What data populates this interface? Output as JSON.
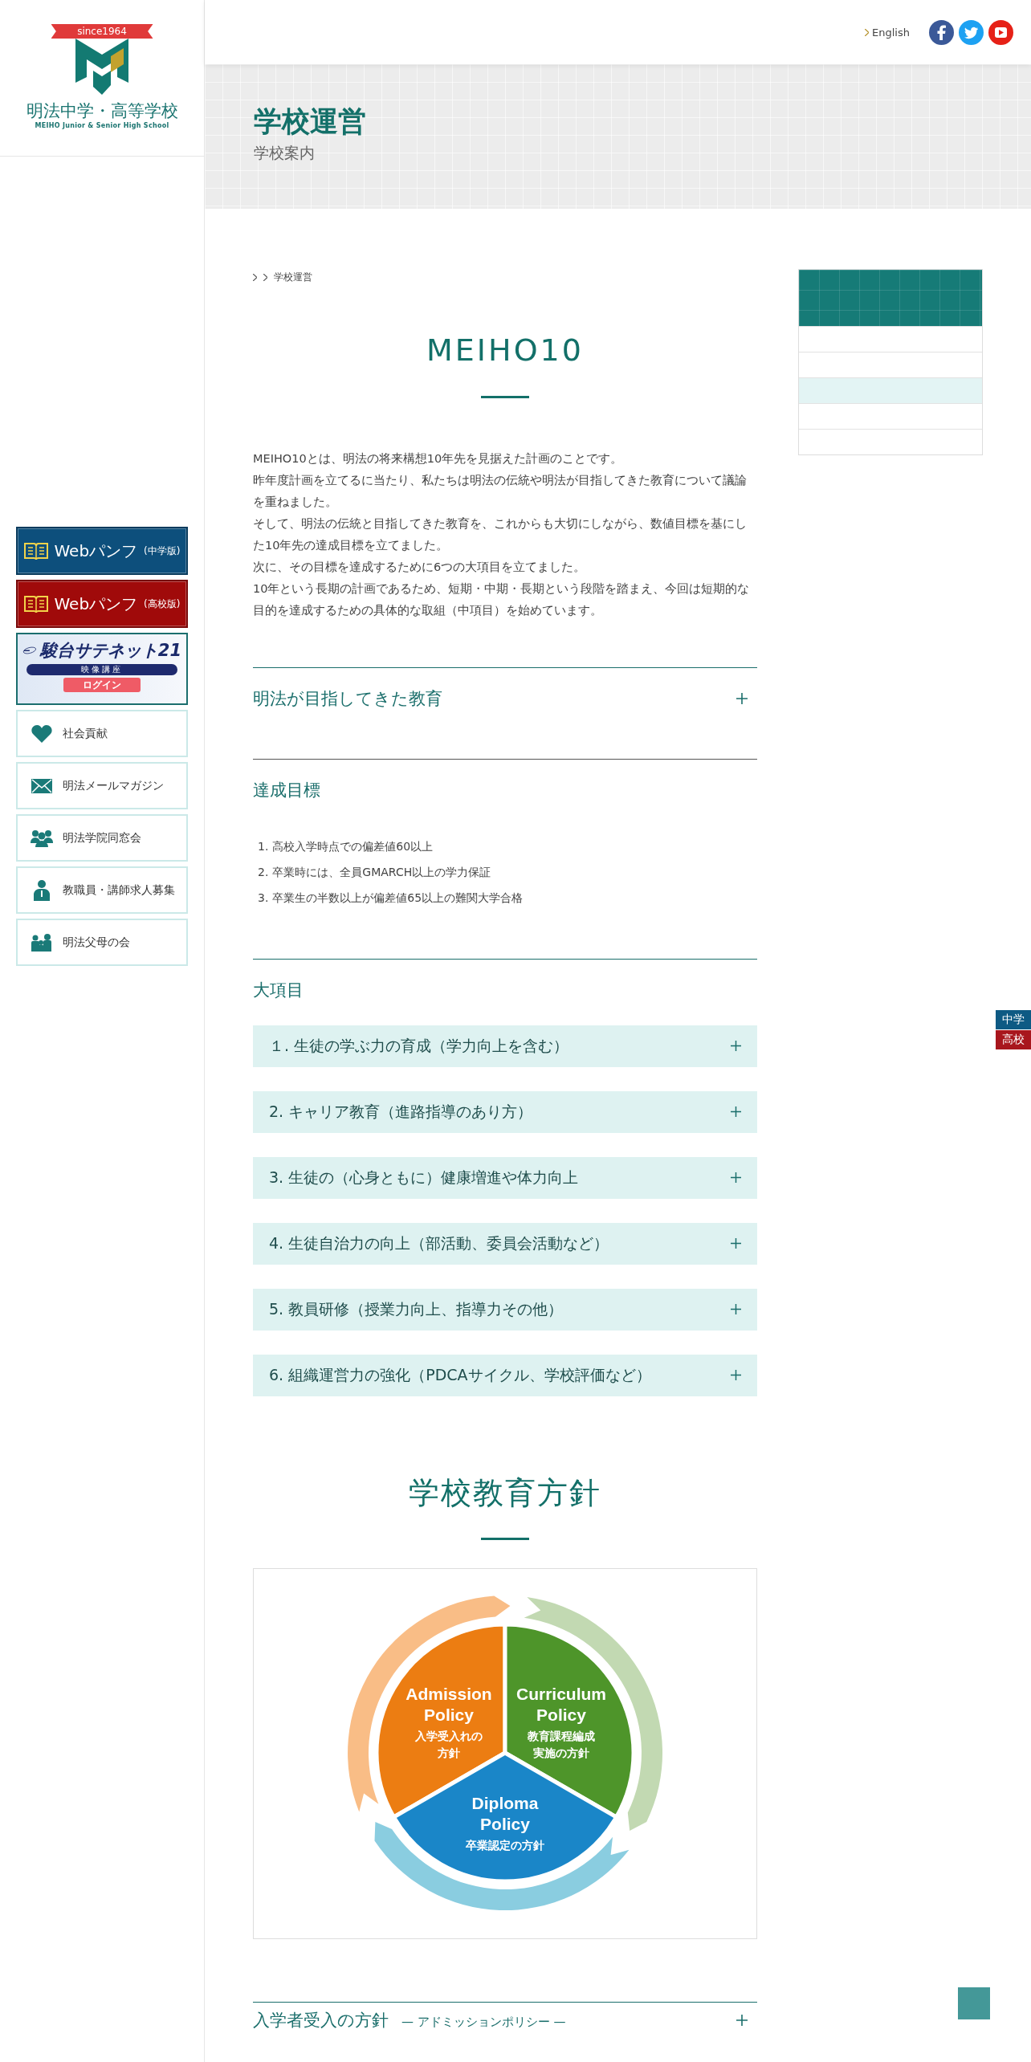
{
  "logo": {
    "badge": "since1964",
    "name": "明法中学・高等学校",
    "subtitle": "MEIHO Junior & Senior High School"
  },
  "header": {
    "language_link": "English",
    "social": [
      {
        "kind": "facebook"
      },
      {
        "kind": "twitter"
      },
      {
        "kind": "youtube"
      }
    ]
  },
  "page_header": {
    "title": "学校運営",
    "subtitle": "学校案内"
  },
  "sidebar": {
    "banners": [
      {
        "label": "Webパンフ",
        "edition": "(中学版)",
        "color": "#0d4f7c"
      },
      {
        "label": "Webパンフ",
        "edition": "(高校版)",
        "color": "#a00a0a"
      }
    ],
    "satenet": {
      "title": "駿台サテネット21",
      "tagline": "映像講座",
      "button": "ログイン"
    },
    "links": [
      {
        "kind": "heart",
        "label": "社会貢献"
      },
      {
        "kind": "mail",
        "label": "明法メールマガジン"
      },
      {
        "kind": "group",
        "label": "明法学院同窓会"
      },
      {
        "kind": "person",
        "label": "教職員・講師求人募集"
      },
      {
        "kind": "family",
        "label": "明法父母の会"
      }
    ]
  },
  "breadcrumb": {
    "current": "学校運営"
  },
  "section": {
    "title": "MEIHO10",
    "intro": [
      "MEIHO10とは、明法の将来構想10年先を見据えた計画のことです。",
      "昨年度計画を立てるに当たり、私たちは明法の伝統や明法が目指してきた教育について議論を重ねました。",
      "そして、明法の伝統と目指してきた教育を、これからも大切にしながら、数値目標を基にした10年先の達成目標を立てました。",
      "次に、その目標を達成するために6つの大項目を立てました。",
      "10年という長期の計画であるため、短期・中期・長期という段階を踏まえ、今回は短期的な目的を達成するための具体的な取組（中項目）を始めています。"
    ]
  },
  "accordion": {
    "title": "明法が目指してきた教育",
    "expanded": false
  },
  "goals": {
    "title": "達成目標",
    "items": [
      {
        "marker": "1.",
        "text": "高校入学時点での偏差値60以上"
      },
      {
        "marker": "2.",
        "text": "卒業時には、全員GMARCH以上の学力保証"
      },
      {
        "marker": "3.",
        "text": "卒業生の半数以上が偏差値65以上の難関大学合格"
      }
    ]
  },
  "major_items": {
    "title": "大項目",
    "items": [
      {
        "label": "１. 生徒の学ぶ力の育成（学力向上を含む）",
        "expanded": false
      },
      {
        "label": "2. キャリア教育（進路指導のあり方）",
        "expanded": false
      },
      {
        "label": "3. 生徒の（心身ともに）健康増進や体力向上",
        "expanded": false
      },
      {
        "label": "4. 生徒自治力の向上（部活動、委員会活動など）",
        "expanded": false
      },
      {
        "label": "5. 教員研修（授業力向上、指導力その他）",
        "expanded": false
      },
      {
        "label": "6. 組織運営力の強化（PDCAサイクル、学校評価など）",
        "expanded": false
      }
    ]
  },
  "policy": {
    "title": "学校教育方針",
    "slices": [
      {
        "kind": "admission",
        "title": [
          "Admission",
          "Policy"
        ],
        "caption": [
          "入学受入れの",
          "方針"
        ]
      },
      {
        "kind": "curriculum",
        "title": [
          "Curriculum",
          "Policy"
        ],
        "caption": [
          "教育課程編成",
          "実施の方針"
        ]
      },
      {
        "kind": "diploma",
        "title": [
          "Diploma",
          "Policy"
        ],
        "caption": [
          "卒業認定の方針"
        ]
      }
    ]
  },
  "policy_accordions": [
    {
      "title": "入学者受入の方針",
      "subtitle": "— アドミッションポリシー —",
      "expanded": false
    }
  ],
  "side_nav": {
    "rows": [
      {
        "selected": false
      },
      {
        "selected": false
      },
      {
        "selected": true
      },
      {
        "selected": false
      },
      {
        "selected": false
      }
    ]
  },
  "school_switch": [
    {
      "label": "中学",
      "color": "#0e5a84"
    },
    {
      "label": "高校",
      "color": "#a8161d"
    }
  ]
}
